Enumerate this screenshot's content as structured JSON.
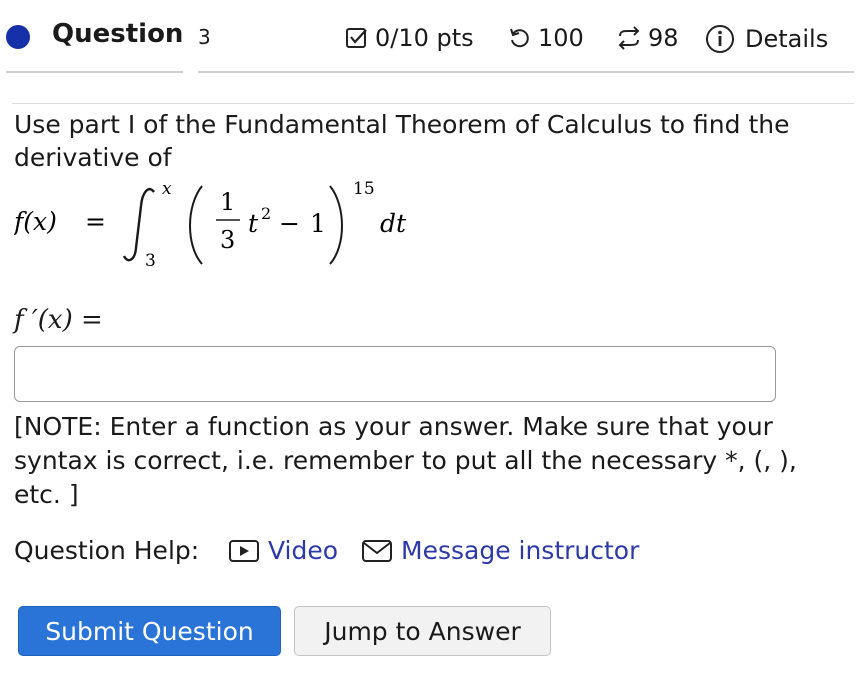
{
  "header": {
    "question_label": "Question",
    "question_number": "3",
    "points": "0/10 pts",
    "retries": "100",
    "attempts": "98",
    "details_label": "Details"
  },
  "question": {
    "prompt": "Use part I of the Fundamental Theorem of Calculus to find the derivative of",
    "formula": {
      "lhs": "f(x)",
      "equals": "=",
      "lower_limit": "3",
      "upper_limit": "x",
      "frac_num": "1",
      "frac_den": "3",
      "base_var": "t",
      "base_exp": "2",
      "minus": "−",
      "constant": "1",
      "outer_exp": "15",
      "differential": "dt"
    },
    "answer_label": "f ′(x) =",
    "answer_value": "",
    "note": "[NOTE: Enter a function as your answer. Make sure that your syntax is correct, i.e. remember to put all the necessary *, (, ), etc. ]"
  },
  "help": {
    "label": "Question Help:",
    "video_label": "Video",
    "message_label": "Message instructor"
  },
  "buttons": {
    "submit_label": "Submit Question",
    "jump_label": "Jump to Answer"
  },
  "colors": {
    "status_dot": "#1530a8",
    "link": "#2d39a8",
    "primary_button": "#2a74d8"
  },
  "icons": [
    "checkbox-icon",
    "retry-icon",
    "attempts-icon",
    "info-icon",
    "video-icon",
    "mail-icon"
  ]
}
